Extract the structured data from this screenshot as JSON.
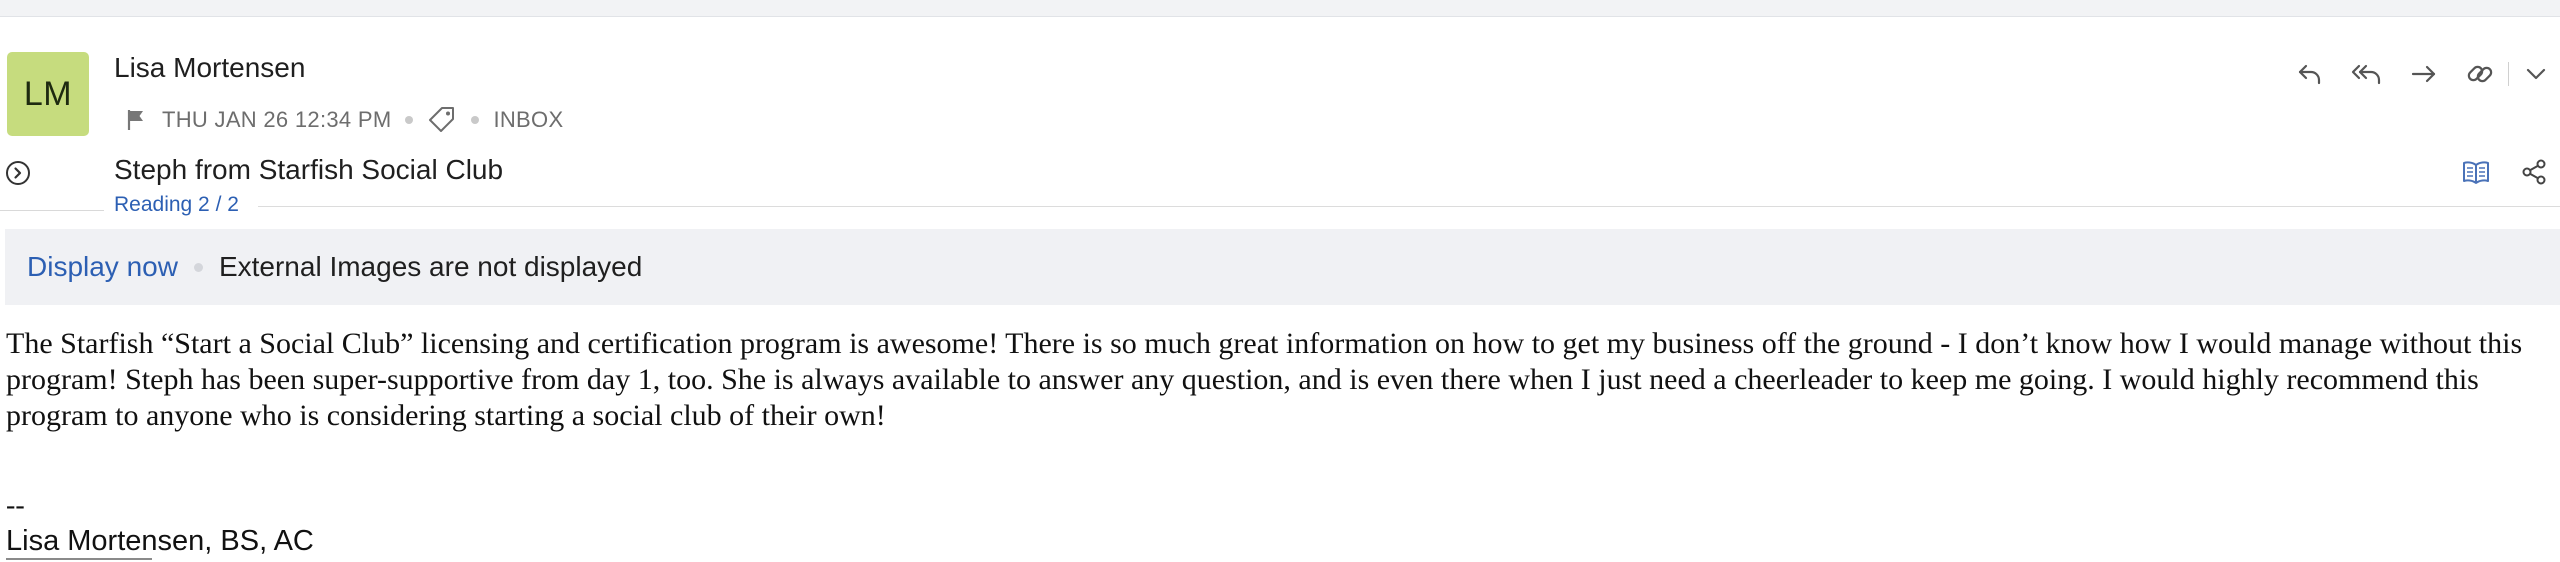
{
  "message": {
    "sender_initials": "LM",
    "sender_name": "Lisa Mortensen",
    "date": "THU JAN 26 12:34 PM",
    "folder": "INBOX",
    "subject": "Steph from Starfish Social Club",
    "reading_status": "Reading 2 / 2"
  },
  "colors": {
    "avatar_bg": "#c6dc7e",
    "link": "#2c5fb3",
    "banner_bg": "#f0f1f4"
  },
  "actions": {
    "icons": [
      "reply-icon",
      "reply-all-icon",
      "forward-icon",
      "link-icon",
      "chevron-down-icon"
    ]
  },
  "side_icons": [
    "reader-view-icon",
    "share-icon"
  ],
  "banner": {
    "display_now": "Display now",
    "notice": "External Images are not displayed"
  },
  "body": {
    "paragraph": "The Starfish “Start a Social Club” licensing and certification program is awesome! There is so much great information on how to get my business off the ground - I don’t know how I would manage without this program! Steph has been super-supportive from day 1, too. She is always available to answer any question, and is even there when I just need a cheerleader to keep me going. I would highly recommend this program to anyone who is considering starting a social club of their own!",
    "signature_dash": "--",
    "signature_name": "Lisa Mortensen, BS, AC"
  }
}
